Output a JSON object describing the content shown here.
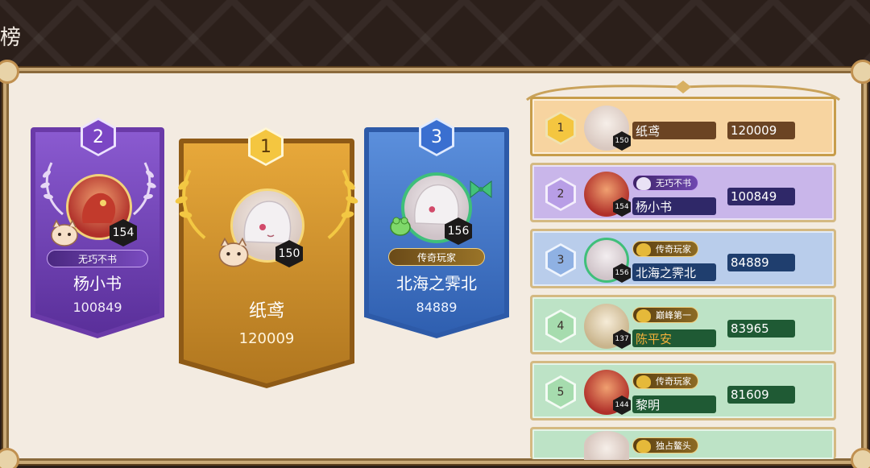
{
  "page": {
    "title": "榜"
  },
  "podium": [
    {
      "rank": "2",
      "name": "杨小书",
      "score": "100849",
      "level": "154",
      "title_tag": "无巧不书"
    },
    {
      "rank": "1",
      "name": "纸鸢",
      "score": "120009",
      "level": "150",
      "title_tag": ""
    },
    {
      "rank": "3",
      "name": "北海之霁北",
      "score": "84889",
      "level": "156",
      "title_tag": "传奇玩家"
    }
  ],
  "leaderboard": [
    {
      "rank": "1",
      "name": "纸鸢",
      "score": "120009",
      "level": "150",
      "title_tag": ""
    },
    {
      "rank": "2",
      "name": "杨小书",
      "score": "100849",
      "level": "154",
      "title_tag": "无巧不书"
    },
    {
      "rank": "3",
      "name": "北海之霁北",
      "score": "84889",
      "level": "156",
      "title_tag": "传奇玩家"
    },
    {
      "rank": "4",
      "name": "陈平安",
      "score": "83965",
      "level": "137",
      "title_tag": "巅峰第一"
    },
    {
      "rank": "5",
      "name": "黎明",
      "score": "81609",
      "level": "144",
      "title_tag": "传奇玩家"
    },
    {
      "rank": "",
      "name": "",
      "score": "",
      "level": "",
      "title_tag": "独占鳌头"
    }
  ],
  "colors": {
    "gold": "#e2a834",
    "purple": "#7b46c4",
    "blue": "#3c6fc2",
    "row1_bg": "#f7d4a0",
    "row2_bg": "#c9b6ea",
    "row3_bg": "#b9cdeb",
    "row_green_bg": "#bde3c6"
  },
  "icons": {
    "crown": "crown-icon",
    "book": "book-icon",
    "gold_ingot": "gold-ingot-icon"
  }
}
